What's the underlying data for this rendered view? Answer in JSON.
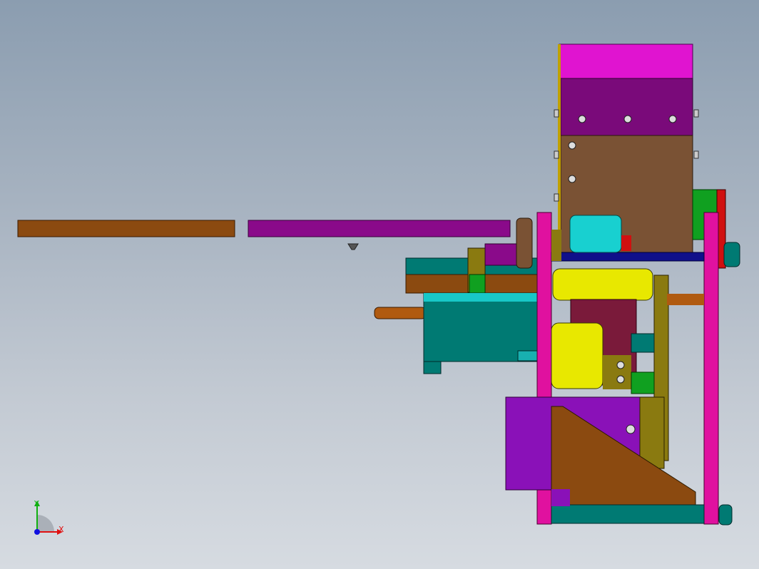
{
  "viewport": {
    "background_top": "#8b9db0",
    "background_bottom": "#d6dbe1"
  },
  "model": {
    "part_colors": {
      "magenta": "#e0119f",
      "purple": "#7a0a7a",
      "violet": "#8a11b8",
      "brown": "#7a5234",
      "orange_brown": "#8b4a10",
      "teal": "#007a73",
      "cyan": "#18d0d0",
      "yellow": "#e8e800",
      "olive": "#8a7a10",
      "green": "#10a020",
      "red": "#d01010",
      "navy": "#10108a"
    }
  },
  "triad": {
    "x_label": "X",
    "y_label": "Y",
    "x_color": "#e01010",
    "y_color": "#10b010",
    "z_color": "#1010e0",
    "icon": "coordinate-triad-icon"
  }
}
